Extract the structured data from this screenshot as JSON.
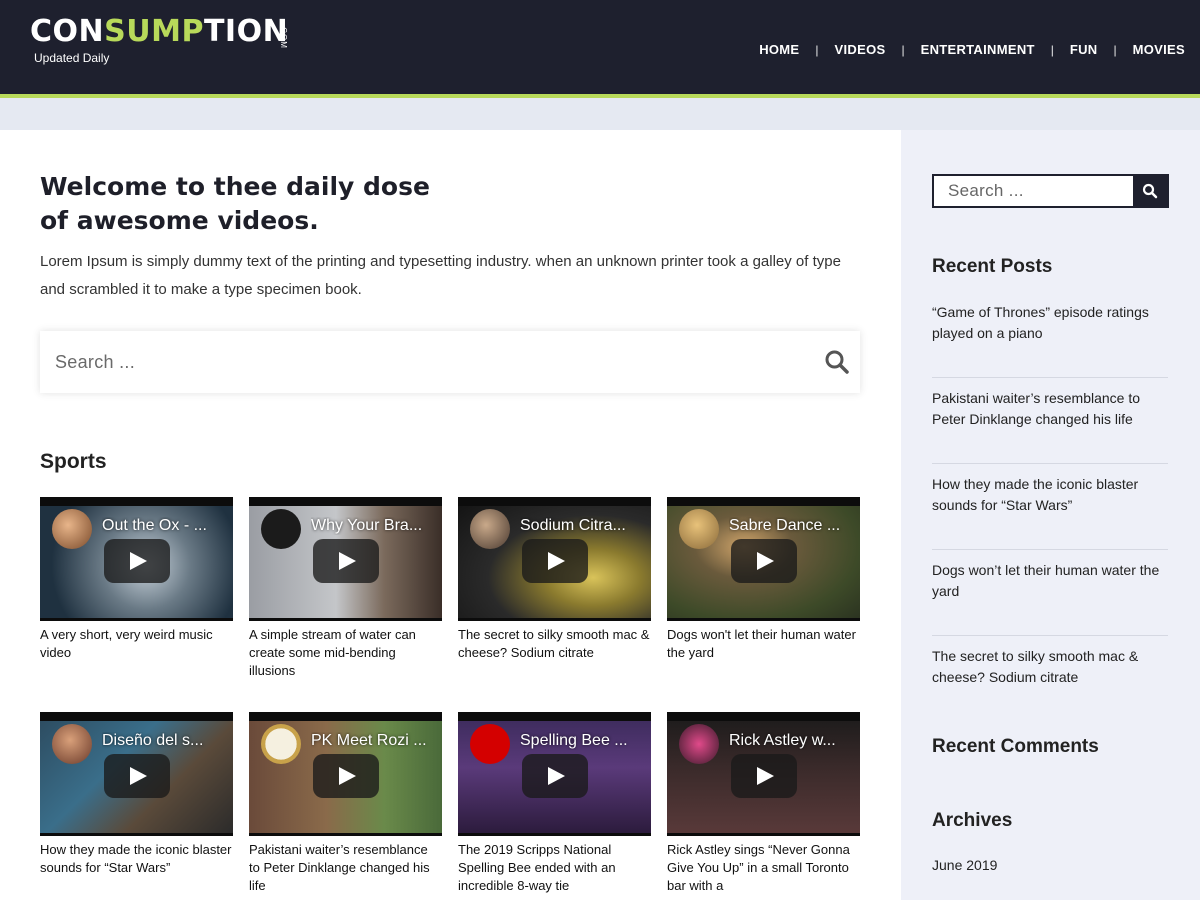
{
  "header": {
    "logo_prefix": "CON",
    "logo_highlight": "SUMP",
    "logo_suffix": "TION",
    "logo_com": ".COM",
    "tagline": "Updated Daily",
    "nav": [
      "HOME",
      "VIDEOS",
      "ENTERTAINMENT",
      "FUN",
      "MOVIES"
    ],
    "nav_separator": "|"
  },
  "main": {
    "title_line1": "Welcome to thee daily dose",
    "title_line2": "of awesome videos.",
    "intro": "Lorem Ipsum is simply dummy text of the printing and typesetting industry. when an unknown printer took a galley of type and scrambled it to make a type specimen book.",
    "search_placeholder": "Search ...",
    "section_title": "Sports",
    "videos": [
      {
        "thumb_title": "Out the Ox - ...",
        "caption": "A very short, very weird music video"
      },
      {
        "thumb_title": "Why Your Bra...",
        "caption": "A simple stream of water can create some mid-bending illusions"
      },
      {
        "thumb_title": "Sodium Citra...",
        "caption": "The secret to silky smooth mac & cheese? Sodium citrate"
      },
      {
        "thumb_title": "Sabre Dance ...",
        "caption": "Dogs won't let their human water the yard"
      },
      {
        "thumb_title": "Diseño del s...",
        "caption": "How they made the iconic blaster sounds for “Star Wars”"
      },
      {
        "thumb_title": "PK Meet Rozi ...",
        "caption": "Pakistani waiter’s resemblance to Peter Dinklange changed his life"
      },
      {
        "thumb_title": "Spelling Bee ...",
        "caption": "The 2019 Scripps National Spelling Bee ended with an incredible 8-way tie"
      },
      {
        "thumb_title": "Rick Astley w...",
        "caption": "Rick Astley sings “Never Gonna Give You Up” in a small Toronto bar with a"
      }
    ]
  },
  "sidebar": {
    "search_placeholder": "Search ...",
    "recent_posts_title": "Recent Posts",
    "recent_posts": [
      "“Game of Thrones” episode ratings played on a piano",
      "Pakistani waiter’s resemblance to Peter Dinklange changed his life",
      "How they made the iconic blaster sounds for “Star Wars”",
      "Dogs won’t let their human water the yard",
      "The secret to silky smooth mac & cheese? Sodium citrate"
    ],
    "recent_comments_title": "Recent Comments",
    "archives_title": "Archives",
    "archives": [
      "June 2019"
    ]
  },
  "colors": {
    "header_bg": "#1e202e",
    "accent": "#b8d95a",
    "sidebar_bg": "#eef0f8"
  }
}
